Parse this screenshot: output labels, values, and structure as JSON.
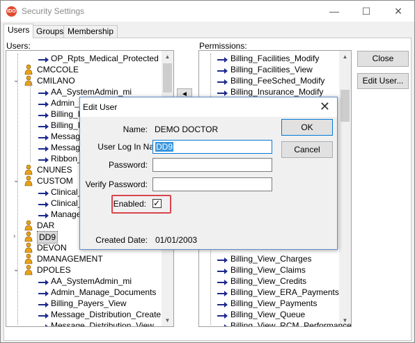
{
  "window": {
    "title": "Security Settings",
    "app_icon_text": "IDO",
    "minimize_glyph": "—",
    "maximize_glyph": "☐",
    "close_glyph": "✕"
  },
  "tabs": [
    {
      "label": "Users",
      "active": true
    },
    {
      "label": "Groups",
      "active": false
    },
    {
      "label": "Membership",
      "active": false
    }
  ],
  "users": {
    "label": "Users:",
    "rows": [
      {
        "text": "OP_Rpts_Medical_Protected",
        "kind": "perm",
        "level": 2
      },
      {
        "text": "CMCCOLE",
        "kind": "user",
        "level": 1
      },
      {
        "text": "CMILANO",
        "kind": "user",
        "level": 1,
        "expanded": true
      },
      {
        "text": "AA_SystemAdmin_mi",
        "kind": "perm",
        "level": 2
      },
      {
        "text": "Admin_M",
        "kind": "perm",
        "level": 2
      },
      {
        "text": "Billing_Fa",
        "kind": "perm",
        "level": 2
      },
      {
        "text": "Billing_P",
        "kind": "perm",
        "level": 2
      },
      {
        "text": "Message",
        "kind": "perm",
        "level": 2
      },
      {
        "text": "Message",
        "kind": "perm",
        "level": 2
      },
      {
        "text": "Ribbon_A",
        "kind": "perm",
        "level": 2
      },
      {
        "text": "CNUNES",
        "kind": "user",
        "level": 1
      },
      {
        "text": "CUSTOM",
        "kind": "user",
        "level": 1,
        "expanded": true
      },
      {
        "text": "Clinical_",
        "kind": "perm",
        "level": 2
      },
      {
        "text": "Clinical_",
        "kind": "perm",
        "level": 2
      },
      {
        "text": "Manage_",
        "kind": "perm",
        "level": 2
      },
      {
        "text": "DAR",
        "kind": "user",
        "level": 1
      },
      {
        "text": "DD9",
        "kind": "user",
        "level": 1,
        "selected": true,
        "collapsed": true
      },
      {
        "text": "DEVON",
        "kind": "user",
        "level": 1
      },
      {
        "text": "DMANAGEMENT",
        "kind": "user",
        "level": 1
      },
      {
        "text": "DPOLES",
        "kind": "user",
        "level": 1,
        "expanded": true
      },
      {
        "text": "AA_SystemAdmin_mi",
        "kind": "perm",
        "level": 2
      },
      {
        "text": "Admin_Manage_Documents",
        "kind": "perm",
        "level": 2
      },
      {
        "text": "Billing_Payers_View",
        "kind": "perm",
        "level": 2
      },
      {
        "text": "Message_Distribution_Create",
        "kind": "perm",
        "level": 2
      },
      {
        "text": "Message_Distribution_View",
        "kind": "perm",
        "level": 2
      }
    ]
  },
  "permissions": {
    "label": "Permissions:",
    "rows_top": [
      "Billing_Facilities_Modify",
      "Billing_Facilities_View",
      "Billing_FeeSched_Modify",
      "Billing_Insurance_Modify"
    ],
    "rows_bottom": [
      "Billing_View_Charges",
      "Billing_View_Claims",
      "Billing_View_Credits",
      "Billing_View_ERA_Payments",
      "Billing_View_Payments",
      "Billing_View_Queue",
      "Billing_View_RCM_Performance"
    ]
  },
  "buttons": {
    "close": "Close",
    "edit_user": "Edit User..."
  },
  "move_glyph": "◄",
  "edit_user_dialog": {
    "title": "Edit User",
    "close_glyph": "✕",
    "name_label": "Name:",
    "name_value": "DEMO DOCTOR",
    "login_label": "User Log In Name:",
    "login_value": "DD9",
    "password_label": "Password:",
    "password_value": "",
    "verify_label": "Verify Password:",
    "verify_value": "",
    "enabled_label": "Enabled:",
    "enabled_checked": true,
    "enabled_check_glyph": "✓",
    "created_label": "Created Date:",
    "created_value": "01/01/2003",
    "ok": "OK",
    "cancel": "Cancel"
  },
  "colors": {
    "arrow_icon": "#1c2a8c",
    "person_icon": "#e7a21b",
    "highlight_box": "#d9444c",
    "selection_blue": "#3a96dd"
  }
}
